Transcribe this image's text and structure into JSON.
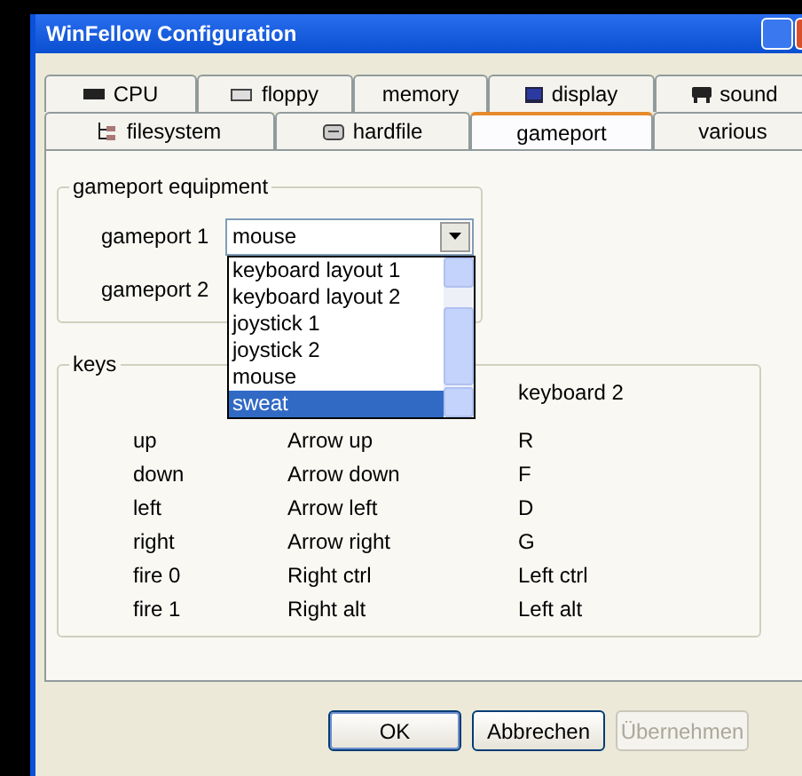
{
  "window": {
    "title": "WinFellow Configuration"
  },
  "tab_rows": [
    [
      {
        "label": "CPU",
        "kind": "cpu",
        "selected": false
      },
      {
        "label": "floppy",
        "kind": "floppy",
        "selected": false
      },
      {
        "label": "memory",
        "kind": "plain",
        "selected": false
      },
      {
        "label": "display",
        "kind": "display",
        "selected": false
      },
      {
        "label": "sound",
        "kind": "sound",
        "selected": false
      }
    ],
    [
      {
        "label": "filesystem",
        "kind": "filesystem",
        "selected": false
      },
      {
        "label": "hardfile",
        "kind": "hardfile",
        "selected": false
      },
      {
        "label": "gameport",
        "kind": "plain",
        "selected": true
      },
      {
        "label": "various",
        "kind": "plain",
        "selected": false
      }
    ]
  ],
  "equipment": {
    "title": "gameport equipment",
    "ports": [
      {
        "label": "gameport 1",
        "value": "mouse"
      },
      {
        "label": "gameport 2"
      }
    ],
    "dropdown": [
      {
        "label": "keyboard layout 1",
        "selected": false
      },
      {
        "label": "keyboard layout 2",
        "selected": false
      },
      {
        "label": "joystick 1",
        "selected": false
      },
      {
        "label": "joystick 2",
        "selected": false
      },
      {
        "label": "mouse",
        "selected": false
      },
      {
        "label": "sweat",
        "selected": true
      }
    ]
  },
  "keys": {
    "title": "keys",
    "header": "keyboard 2",
    "rows": [
      {
        "action": "up",
        "keyboard_1": "Arrow up",
        "keyboard_2": "R"
      },
      {
        "action": "down",
        "keyboard_1": "Arrow down",
        "keyboard_2": "F"
      },
      {
        "action": "left",
        "keyboard_1": "Arrow left",
        "keyboard_2": "D"
      },
      {
        "action": "right",
        "keyboard_1": "Arrow right",
        "keyboard_2": "G"
      },
      {
        "action": "fire 0",
        "keyboard_1": "Right ctrl",
        "keyboard_2": "Left ctrl"
      },
      {
        "action": "fire 1",
        "keyboard_1": "Right alt",
        "keyboard_2": "Left alt"
      }
    ]
  },
  "buttons": [
    {
      "label": "OK",
      "default": true,
      "disabled": false
    },
    {
      "label": "Abbrechen",
      "default": false,
      "disabled": false
    },
    {
      "label": "Übernehmen",
      "default": false,
      "disabled": true
    }
  ]
}
